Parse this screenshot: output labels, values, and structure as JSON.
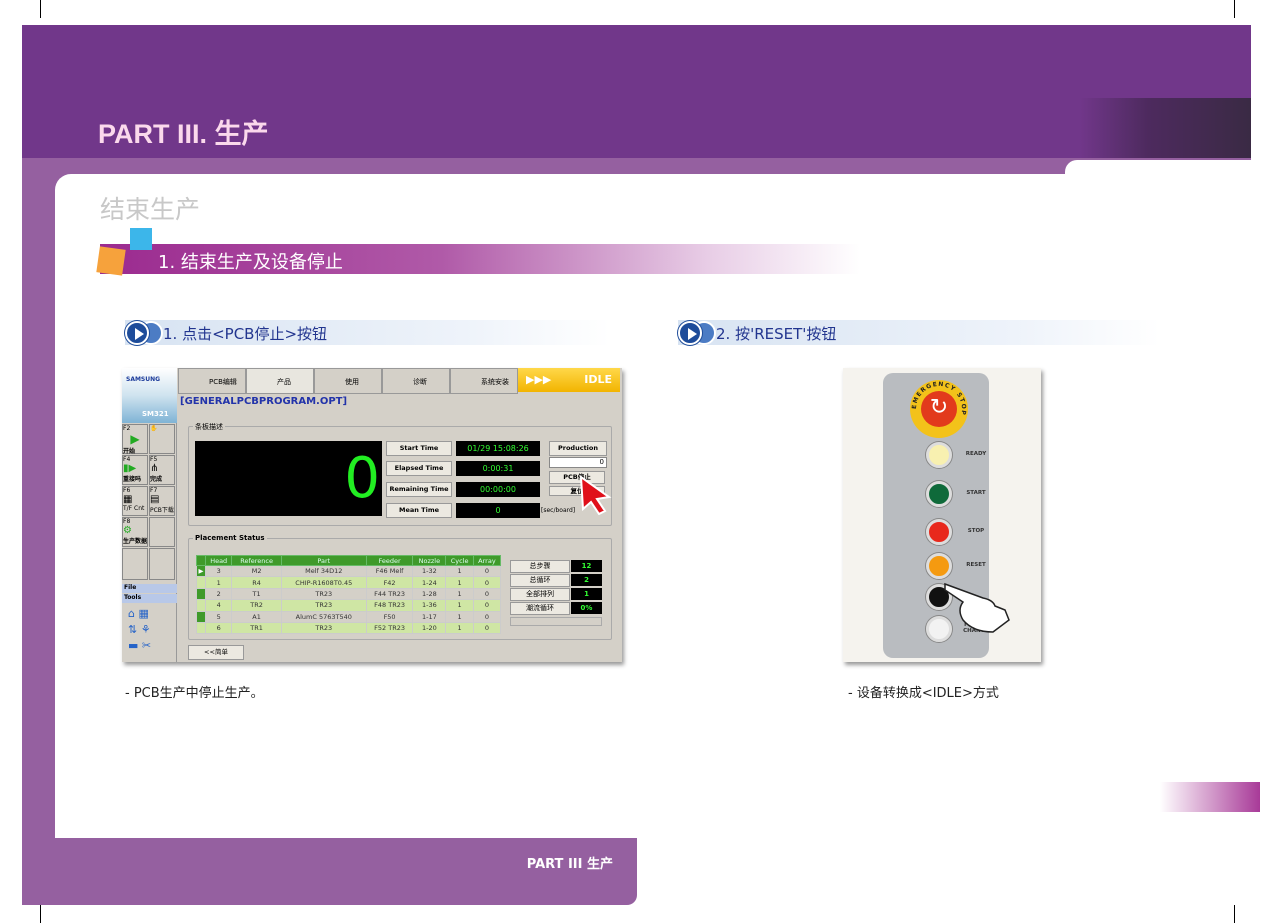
{
  "header": {
    "part_title": "PART III. 生产",
    "page_title": "结束生产"
  },
  "section": {
    "title": "1. 结束生产及设备停止"
  },
  "step1": {
    "title": "1. 点击<PCB停止>按钮",
    "note": "- PCB生产中停止生产。"
  },
  "step2": {
    "title": "2. 按'RESET'按钮",
    "note": "- 设备转换成<IDLE>方式"
  },
  "footer": {
    "text": "PART III 生产"
  },
  "software": {
    "logo": "SAMSUNG",
    "model": "SM321",
    "tabs": [
      "PCB编辑",
      "产品",
      "使用",
      "诊断",
      "系统安装"
    ],
    "status": "IDLE",
    "program": "[GENERALPCBPROGRAM.OPT]",
    "fkeys": [
      {
        "key": "F2",
        "label": "开始"
      },
      {
        "key": "F3",
        "label": ""
      },
      {
        "key": "F4",
        "label": "重接吗"
      },
      {
        "key": "F5",
        "label": "完成"
      },
      {
        "key": "F6",
        "label": "T/F Cnt"
      },
      {
        "key": "F7",
        "label": "PCB下载"
      },
      {
        "key": "F8",
        "label": "生产数据"
      }
    ],
    "menus": [
      "File",
      "Tools"
    ],
    "board_group": "条板描述",
    "count": "0",
    "times": [
      {
        "label": "Start Time",
        "value": "01/29 15:08:26"
      },
      {
        "label": "Elapsed Time",
        "value": "0:00:31"
      },
      {
        "label": "Remaining Time",
        "value": "00:00:00"
      },
      {
        "label": "Mean Time",
        "value": "0"
      }
    ],
    "mean_unit": "[sec/board]",
    "production_plan": {
      "label": "Production Plan",
      "value": "0"
    },
    "pcb_stop": "PCB停止",
    "other_btn": "复位",
    "placement": {
      "title": "Placement Status",
      "columns": [
        "Head",
        "Reference",
        "Part",
        "Feeder",
        "Nozzle",
        "Cycle",
        "Array"
      ],
      "rows": [
        [
          "3",
          "M2",
          "Melf 34D12",
          "F46 Melf",
          "1-32",
          "1",
          "0"
        ],
        [
          "1",
          "R4",
          "CHIP-R1608T0.45",
          "F42",
          "1-24",
          "1",
          "0"
        ],
        [
          "2",
          "T1",
          "TR23",
          "F44 TR23",
          "1-28",
          "1",
          "0"
        ],
        [
          "4",
          "TR2",
          "TR23",
          "F48 TR23",
          "1-36",
          "1",
          "0"
        ],
        [
          "5",
          "A1",
          "AlumC 5763T540",
          "F50",
          "1-17",
          "1",
          "0"
        ],
        [
          "6",
          "TR1",
          "TR23",
          "F52 TR23",
          "1-20",
          "1",
          "0"
        ]
      ]
    },
    "stats": [
      {
        "label": "总步骤",
        "value": "12"
      },
      {
        "label": "总循环",
        "value": "2"
      },
      {
        "label": "全部排列",
        "value": "1"
      },
      {
        "label": "潮流循环",
        "value": "0%"
      }
    ],
    "simple_btn": "<<简单"
  },
  "panel": {
    "estop": "EMERGENCY STOP",
    "buttons": [
      {
        "label": "READY",
        "color": "#f8f0b0"
      },
      {
        "label": "START",
        "color": "#0f6a3a"
      },
      {
        "label": "STOP",
        "color": "#e8281c"
      },
      {
        "label": "RESET",
        "color": "#f59a10"
      },
      {
        "label": "",
        "color": "#111111"
      },
      {
        "label": "FEEDER CHANGE",
        "color": "#f2f2f2"
      }
    ]
  }
}
